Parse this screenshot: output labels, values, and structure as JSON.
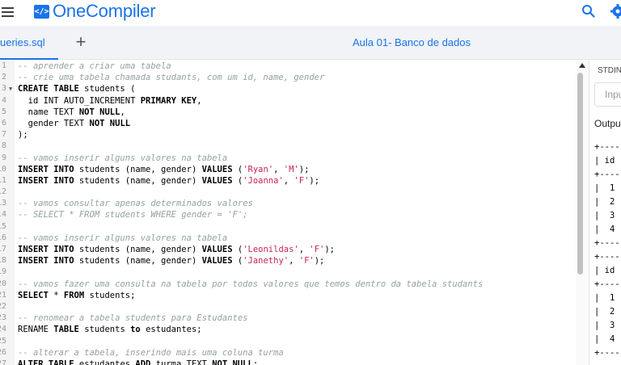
{
  "header": {
    "logo_badge": "</>",
    "app_name": "OneCompiler",
    "menu_icon": "hamburger-menu-icon",
    "search_icon": "search-icon",
    "settings_icon": "gear-icon",
    "brand_color": "#1a73e8"
  },
  "tabs": {
    "file_tab_label": "ueries.sql",
    "add_label": "+",
    "project_title": "Aula 01- Banco de dados"
  },
  "editor": {
    "lines": [
      {
        "n": "1",
        "fold": false,
        "tokens": [
          {
            "t": "c",
            "v": "-- aprender a criar uma tabela"
          }
        ]
      },
      {
        "n": "2",
        "fold": false,
        "tokens": [
          {
            "t": "c",
            "v": "-- crie uma tabela chamada studants, com um id, name, gender"
          }
        ]
      },
      {
        "n": "3",
        "fold": true,
        "tokens": [
          {
            "t": "k",
            "v": "CREATE TABLE"
          },
          {
            "t": "p",
            "v": " students ("
          }
        ]
      },
      {
        "n": "4",
        "fold": false,
        "tokens": [
          {
            "t": "p",
            "v": "  id INT AUTO_INCREMENT "
          },
          {
            "t": "k",
            "v": "PRIMARY KEY"
          },
          {
            "t": "p",
            "v": ","
          }
        ]
      },
      {
        "n": "5",
        "fold": false,
        "tokens": [
          {
            "t": "p",
            "v": "  name TEXT "
          },
          {
            "t": "k",
            "v": "NOT NULL"
          },
          {
            "t": "p",
            "v": ","
          }
        ]
      },
      {
        "n": "6",
        "fold": false,
        "tokens": [
          {
            "t": "p",
            "v": "  gender TEXT "
          },
          {
            "t": "k",
            "v": "NOT NULL"
          }
        ]
      },
      {
        "n": "7",
        "fold": false,
        "tokens": [
          {
            "t": "p",
            "v": ");"
          }
        ]
      },
      {
        "n": "8",
        "fold": false,
        "tokens": []
      },
      {
        "n": "9",
        "fold": false,
        "tokens": [
          {
            "t": "c",
            "v": "-- vamos inserir alguns valores na tabela"
          }
        ]
      },
      {
        "n": "10",
        "fold": false,
        "tokens": [
          {
            "t": "k",
            "v": "INSERT INTO"
          },
          {
            "t": "p",
            "v": " students (name, gender) "
          },
          {
            "t": "k",
            "v": "VALUES"
          },
          {
            "t": "p",
            "v": " ("
          },
          {
            "t": "s",
            "v": "'Ryan'"
          },
          {
            "t": "p",
            "v": ", "
          },
          {
            "t": "s",
            "v": "'M'"
          },
          {
            "t": "p",
            "v": ");"
          }
        ]
      },
      {
        "n": "11",
        "fold": false,
        "tokens": [
          {
            "t": "k",
            "v": "INSERT INTO"
          },
          {
            "t": "p",
            "v": " students (name, gender) "
          },
          {
            "t": "k",
            "v": "VALUES"
          },
          {
            "t": "p",
            "v": " ("
          },
          {
            "t": "s",
            "v": "'Joanna'"
          },
          {
            "t": "p",
            "v": ", "
          },
          {
            "t": "s",
            "v": "'F'"
          },
          {
            "t": "p",
            "v": ");"
          }
        ]
      },
      {
        "n": "12",
        "fold": false,
        "tokens": []
      },
      {
        "n": "13",
        "fold": false,
        "tokens": [
          {
            "t": "c",
            "v": "-- vamos consultar apenas determinados valores"
          }
        ]
      },
      {
        "n": "14",
        "fold": false,
        "tokens": [
          {
            "t": "c",
            "v": "-- SELECT * FROM students WHERE gender = 'F';"
          }
        ]
      },
      {
        "n": "15",
        "fold": false,
        "tokens": []
      },
      {
        "n": "16",
        "fold": false,
        "tokens": [
          {
            "t": "c",
            "v": "-- vamos inserir alguns valores na tabela"
          }
        ]
      },
      {
        "n": "17",
        "fold": false,
        "tokens": [
          {
            "t": "k",
            "v": "INSERT INTO"
          },
          {
            "t": "p",
            "v": " students (name, gender) "
          },
          {
            "t": "k",
            "v": "VALUES"
          },
          {
            "t": "p",
            "v": " ("
          },
          {
            "t": "s",
            "v": "'Leonildas'"
          },
          {
            "t": "p",
            "v": ", "
          },
          {
            "t": "s",
            "v": "'F'"
          },
          {
            "t": "p",
            "v": ");"
          }
        ]
      },
      {
        "n": "18",
        "fold": false,
        "tokens": [
          {
            "t": "k",
            "v": "INSERT INTO"
          },
          {
            "t": "p",
            "v": " students (name, gender) "
          },
          {
            "t": "k",
            "v": "VALUES"
          },
          {
            "t": "p",
            "v": " ("
          },
          {
            "t": "s",
            "v": "'Janethy'"
          },
          {
            "t": "p",
            "v": ", "
          },
          {
            "t": "s",
            "v": "'F'"
          },
          {
            "t": "p",
            "v": ");"
          }
        ]
      },
      {
        "n": "19",
        "fold": false,
        "tokens": []
      },
      {
        "n": "20",
        "fold": false,
        "tokens": [
          {
            "t": "c",
            "v": "-- vamos fazer uma consulta na tabela por todos valores que temos dentro da tabela studants"
          }
        ]
      },
      {
        "n": "21",
        "fold": false,
        "tokens": [
          {
            "t": "k",
            "v": "SELECT"
          },
          {
            "t": "p",
            "v": " * "
          },
          {
            "t": "k",
            "v": "FROM"
          },
          {
            "t": "p",
            "v": " students;"
          }
        ]
      },
      {
        "n": "22",
        "fold": false,
        "tokens": []
      },
      {
        "n": "23",
        "fold": false,
        "tokens": [
          {
            "t": "c",
            "v": "-- renomear a tabela students para Estudantes"
          }
        ]
      },
      {
        "n": "24",
        "fold": false,
        "tokens": [
          {
            "t": "p",
            "v": "RENAME "
          },
          {
            "t": "k",
            "v": "TABLE"
          },
          {
            "t": "p",
            "v": " students "
          },
          {
            "t": "k",
            "v": "to"
          },
          {
            "t": "p",
            "v": " estudantes;"
          }
        ]
      },
      {
        "n": "25",
        "fold": false,
        "tokens": []
      },
      {
        "n": "26",
        "fold": false,
        "tokens": [
          {
            "t": "c",
            "v": "-- alterar a tabela, inserindo mais uma coluna turma"
          }
        ]
      },
      {
        "n": "27",
        "fold": false,
        "tokens": [
          {
            "t": "k",
            "v": "ALTER TABLE"
          },
          {
            "t": "p",
            "v": " estudantes "
          },
          {
            "t": "k",
            "v": "ADD"
          },
          {
            "t": "p",
            "v": " turma TEXT "
          },
          {
            "t": "k",
            "v": "NOT NULL"
          },
          {
            "t": "p",
            "v": ";"
          }
        ]
      }
    ]
  },
  "right_panel": {
    "stdin_label": "STDIN",
    "input_placeholder": "Input for the program",
    "output_label": "Output:",
    "output_lines": [
      "+----",
      "| id",
      "+----",
      "|  1",
      "|  2",
      "|  3",
      "|  4",
      "+----",
      "+----",
      "| id",
      "+----",
      "|  1",
      "|  2",
      "|  3",
      "|  4",
      "+----"
    ]
  }
}
